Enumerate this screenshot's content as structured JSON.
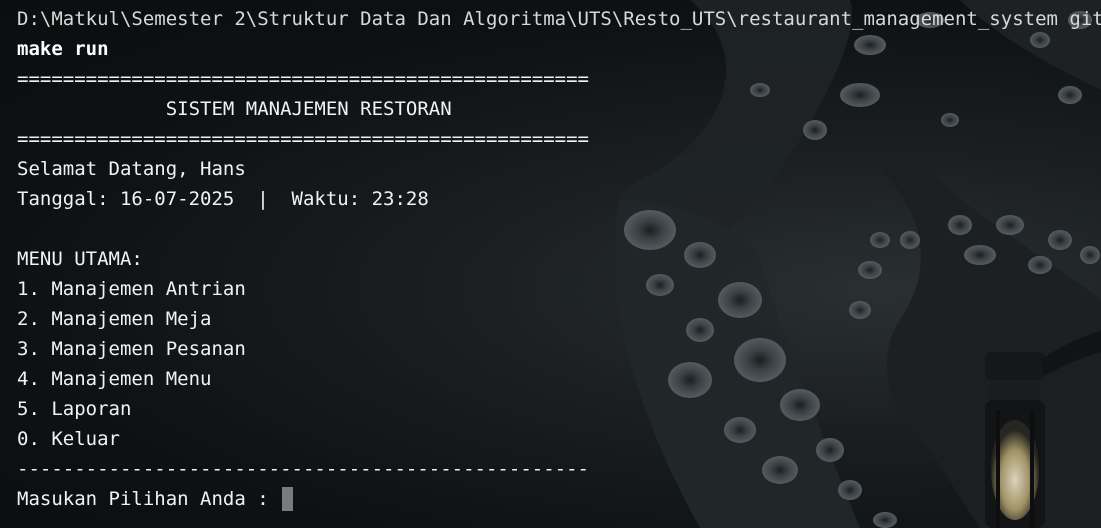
{
  "terminal": {
    "prompt_path": "D:\\Matkul\\Semester 2\\Struktur Data Dan Algoritma\\UTS\\Resto_UTS\\restaurant_management_system git:(main)",
    "command": "make run",
    "separator_double": "==================================================",
    "title": "             SISTEM MANAJEMEN RESTORAN",
    "greeting": "Selamat Datang, Hans",
    "date_time": "Tanggal: 16-07-2025  |  Waktu: 23:28",
    "blank": "",
    "menu_heading": "MENU UTAMA:",
    "menu_items": [
      "1. Manajemen Antrian",
      "2. Manajemen Meja",
      "3. Manajemen Pesanan",
      "4. Manajemen Menu",
      "5. Laporan",
      "0. Keluar"
    ],
    "separator_single": "--------------------------------------------------",
    "input_prompt": "Masukan Pilihan Anda : "
  },
  "colors": {
    "background": "#0c0e10",
    "text": "#f2f2f2",
    "cursor": "#7b7b7b"
  }
}
